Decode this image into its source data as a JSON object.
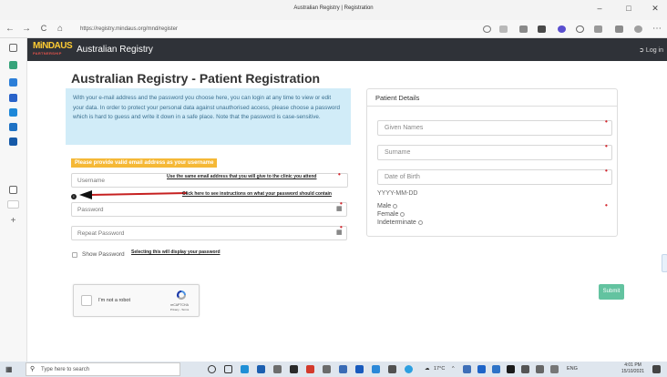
{
  "browser": {
    "window_title": "Australian Registry | Registration",
    "url": "https://registry.mindaus.org/mnd/register",
    "back": "←",
    "forward": "→",
    "reload": "C",
    "home": "⌂",
    "minimize": "–",
    "maximize": "□",
    "close": "✕",
    "more": "⋯"
  },
  "app": {
    "logo_main": "MiNDAUS",
    "logo_sub": "PARTNERSHIP",
    "brand": "Australian Registry",
    "login": "Log in"
  },
  "page": {
    "title": "Australian Registry - Patient Registration",
    "info_text": "With your e-mail address and the password you choose here, you can login at any time to view or edit your data. In order to protect your personal data against unauthorised access, please choose a password which is hard to guess and write it down in a safe place. Note that the password is case-sensitive.",
    "warning": "Please provide valid email address as your username",
    "username_placeholder": "Username",
    "username_hint": "Use the same email address that you will give to the clinic you attend",
    "password_hint": "Click here to see instructions on what your password should contain",
    "password_placeholder": "Password",
    "repeat_placeholder": "Repeat Password",
    "show_password": "Show Password",
    "show_password_hint": "Selecting this will display your password",
    "captcha_label": "I'm not a robot",
    "captcha_brand": "reCAPTCHA",
    "captcha_terms": "Privacy - Terms",
    "submit": "Submit"
  },
  "patient": {
    "heading": "Patient Details",
    "given_names": "Given Names",
    "surname": "Surname",
    "dob": "Date of Birth",
    "dob_format": "YYYY-MM-DD",
    "genders": [
      "Male",
      "Female",
      "Indeterminate"
    ]
  },
  "taskbar": {
    "search_placeholder": "Type here to search",
    "temperature": "17°C",
    "language": "ENG",
    "time": "4:01 PM",
    "date": "15/10/2021"
  },
  "colors": {
    "appbar": "#2f3238",
    "info_bg": "#d1ecf8",
    "warning_bg": "#f5b836",
    "required": "#d3242c",
    "submit": "#63c3a0"
  }
}
